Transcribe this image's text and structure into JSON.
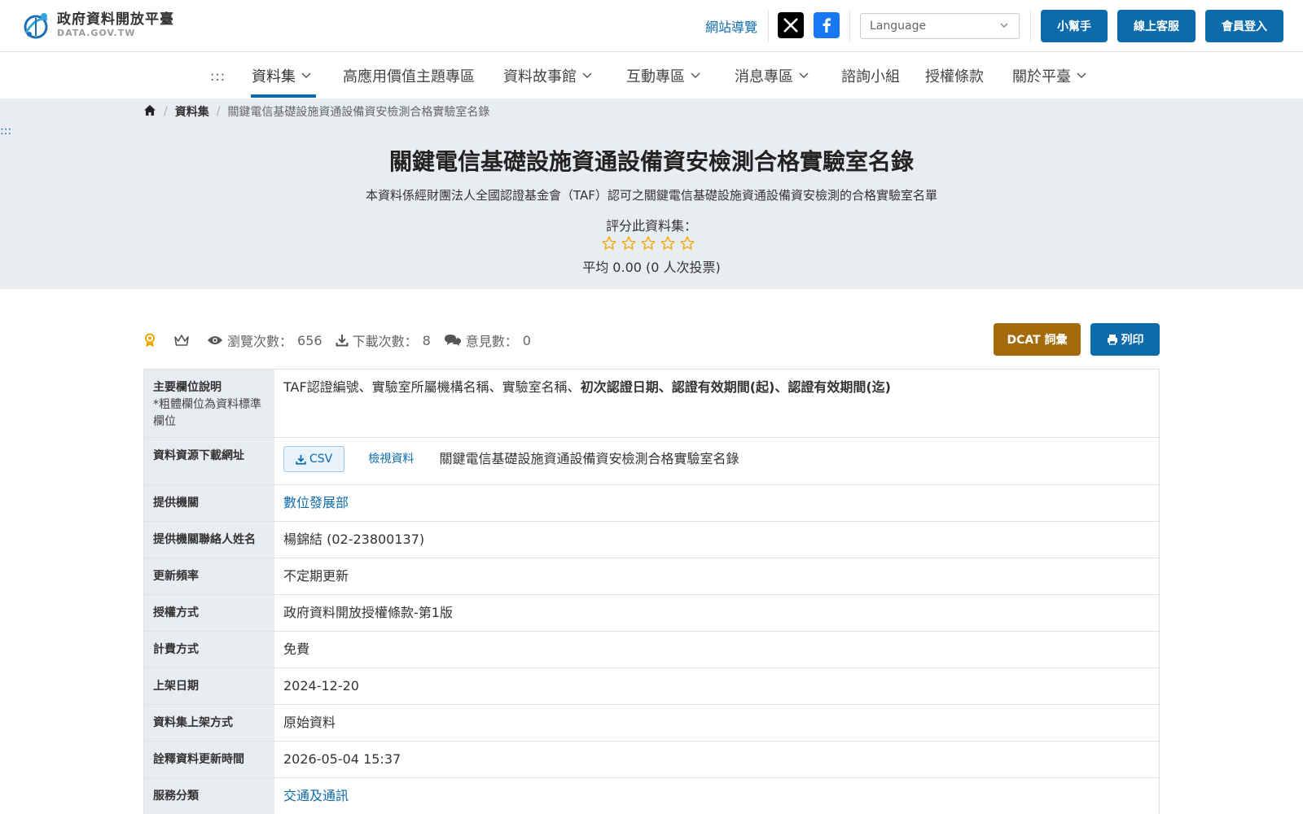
{
  "header": {
    "logo_title": "政府資料開放平臺",
    "logo_sub": "DATA.GOV.TW",
    "sitemap": "網站導覽",
    "language_placeholder": "Language",
    "buttons": {
      "helper": "小幫手",
      "service": "線上客服",
      "login": "會員登入"
    }
  },
  "nav": {
    "dots": ":::",
    "items": [
      "資料集",
      "高應用價值主題專區",
      "資料故事館",
      "互動專區",
      "消息專區",
      "諮詢小組",
      "授權條款",
      "關於平臺"
    ]
  },
  "hero": {
    "left_dots": ":::",
    "breadcrumb": {
      "home": "home-icon",
      "dataset": "資料集",
      "current": "關鍵電信基礎設施資通設備資安檢測合格實驗室名錄"
    },
    "title": "關鍵電信基礎設施資通設備資安檢測合格實驗室名錄",
    "description": "本資料係經財團法人全國認證基金會（TAF）認可之關鍵電信基礎設施資通設備資安檢測的合格實驗室名單",
    "rate_label": "評分此資料集：",
    "rating_stars": 0,
    "average": "平均 0.00 (0 人次投票)"
  },
  "stats": {
    "views_label": "瀏覽次數：",
    "views": "656",
    "downloads_label": "下載次數：",
    "downloads": "8",
    "comments_label": "意見數：",
    "comments": "0"
  },
  "actions": {
    "dcat": "DCAT 詞彙",
    "print": "列印"
  },
  "table": {
    "main_fields_label": "主要欄位說明",
    "main_fields_note": "*粗體欄位為資料標準欄位",
    "main_fields_plain": "TAF認證編號、實驗室所屬機構名稱、實驗室名稱、",
    "main_fields_bold": "初次認證日期、認證有效期間(起)、認證有效期間(迄)",
    "download_label": "資料資源下載網址",
    "csv": "CSV",
    "view_data": "檢視資料",
    "resource_name": "關鍵電信基礎設施資通設備資安檢測合格實驗室名錄",
    "provider_label": "提供機關",
    "provider": "數位發展部",
    "contact_label": "提供機關聯絡人姓名",
    "contact": "楊錦結 (02-23800137)",
    "frequency_label": "更新頻率",
    "frequency": "不定期更新",
    "license_label": "授權方式",
    "license": "政府資料開放授權條款-第1版",
    "fee_label": "計費方式",
    "fee": "免費",
    "published_label": "上架日期",
    "published": "2024-12-20",
    "method_label": "資料集上架方式",
    "method": "原始資料",
    "meta_updated_label": "詮釋資料更新時間",
    "meta_updated": "2026-05-04 15:37",
    "category_label": "服務分類",
    "category": "交通及通訊"
  },
  "colors": {
    "primary": "#0b6bab",
    "dcat": "#a36b0b",
    "hero_bg": "#e9ecf1",
    "star": "#e8a800"
  }
}
